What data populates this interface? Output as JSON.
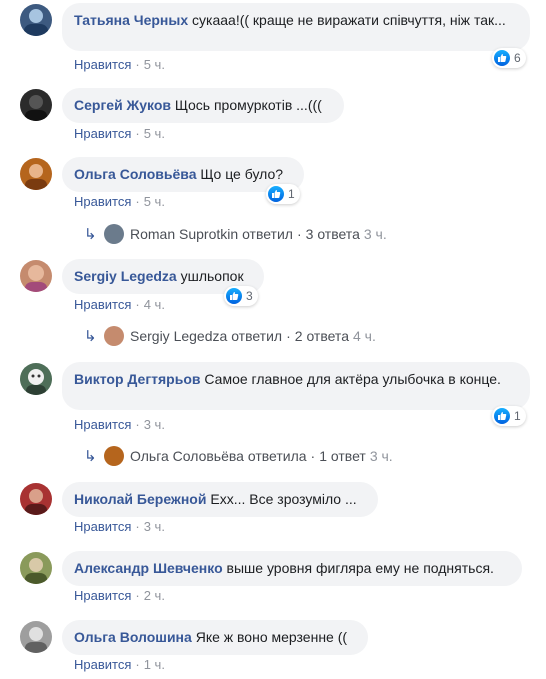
{
  "comments": [
    {
      "author": "Татьяна Черных",
      "text": "сукааа!(( краще не виражати співчуття, ніж так...",
      "like": "Нравится",
      "time": "5 ч.",
      "reactions": "6",
      "avatar_color": "#3d5a80"
    },
    {
      "author": "Сергей Жуков",
      "text": "Щось промуркотів ...(((",
      "like": "Нравится",
      "time": "5 ч.",
      "avatar_color": "#2b2b2b"
    },
    {
      "author": "Ольга Соловьёва",
      "text": "Що це було?",
      "like": "Нравится",
      "time": "5 ч.",
      "reactions": "1",
      "avatar_color": "#b5651d",
      "reply": {
        "name": "Roman Suprotkin",
        "verb": "ответил",
        "count": "3 ответа",
        "time": "3 ч."
      }
    },
    {
      "author": "Sergiy Legedza",
      "text": "ушльопок",
      "like": "Нравится",
      "time": "4 ч.",
      "reactions": "3",
      "avatar_color": "#c58b6e",
      "reply": {
        "name": "Sergiy Legedza",
        "verb": "ответил",
        "count": "2 ответа",
        "time": "4 ч."
      }
    },
    {
      "author": "Виктор Дегтярьов",
      "text": "Самое главное для актёра улыбочка в конце.",
      "like": "Нравится",
      "time": "3 ч.",
      "reactions": "1",
      "avatar_color": "#4e6e58",
      "reply": {
        "name": "Ольга Соловьёва",
        "verb": "ответила",
        "count": "1 ответ",
        "time": "3 ч."
      }
    },
    {
      "author": "Николай Бережной",
      "text": "Ехх... Все зрозуміло ...",
      "like": "Нравится",
      "time": "3 ч.",
      "avatar_color": "#a83232"
    },
    {
      "author": "Александр Шевченко",
      "text": "выше уровня фигляра ему не подняться.",
      "like": "Нравится",
      "time": "2 ч.",
      "avatar_color": "#8a9a5b"
    },
    {
      "author": "Ольга Волошина",
      "text": "Яке ж воно мерзенне ((",
      "like": "Нравится",
      "time": "1 ч.",
      "avatar_color": "#9e9e9e"
    }
  ],
  "colors": {
    "link": "#385898",
    "bubble": "#f2f3f5",
    "meta": "#90949c",
    "like_badge": "#0062df"
  },
  "icons": {
    "reaction": "thumbs-up-icon",
    "reply": "reply-arrow-icon"
  }
}
